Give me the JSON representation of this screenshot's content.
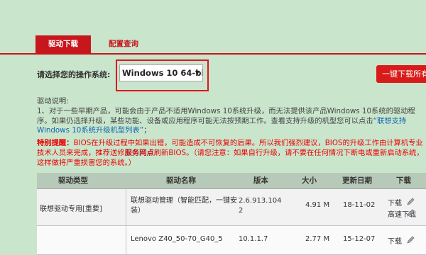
{
  "tabs": {
    "active": "驱动下载",
    "inactive": "配置查询"
  },
  "os": {
    "label": "请选择您的操作系统:",
    "selected": "Windows 10 64-bi",
    "arrow": "▼"
  },
  "download_all": "一键下载所有",
  "notes": {
    "title": "驱动说明:",
    "p1": "1、对于一些早期产品，可能会由于产品不适用Windows 10系统升级，而无法提供该产品Windows 10系统的驱动程序。如果仍选择升级，某些功能、设备或应用程序可能无法按预期工作。查看支持升级的机型您可以点击",
    "link": "“联想支持Windows 10系统升级机型列表”",
    "end": "；"
  },
  "warning": {
    "label": "特别提醒：",
    "text1": "BIOS在升级过程中如果出错，可能造成不可恢复的后果。所以我们强烈建议，BIOS的升级工作由计算机专业技术人员来完成，推荐送修",
    "service": "服务网点",
    "text2": "刷新BIOS。（请您注意：如果自行升级，请不要在任何情况下断电或重新启动系统，这样做将严重损害您的系统。）"
  },
  "table": {
    "headers": {
      "type": "驱动类型",
      "name": "驱动名称",
      "version": "版本",
      "size": "大小",
      "date": "更新日期",
      "download": "下载"
    },
    "rows": [
      {
        "type": "联想驱动专用[重要]",
        "name": "联想驱动管理（智能匹配，一键安装）",
        "version": "2.6.913.1042",
        "size": "4.91 M",
        "date": "18-11-02",
        "download": "下载",
        "fast": "高速下载"
      },
      {
        "type": "",
        "name": "Lenovo Z40_50-70_G40_5",
        "version": "10.1.1.7",
        "size": "2.77 M",
        "date": "15-12-07",
        "download": "下载"
      }
    ]
  }
}
